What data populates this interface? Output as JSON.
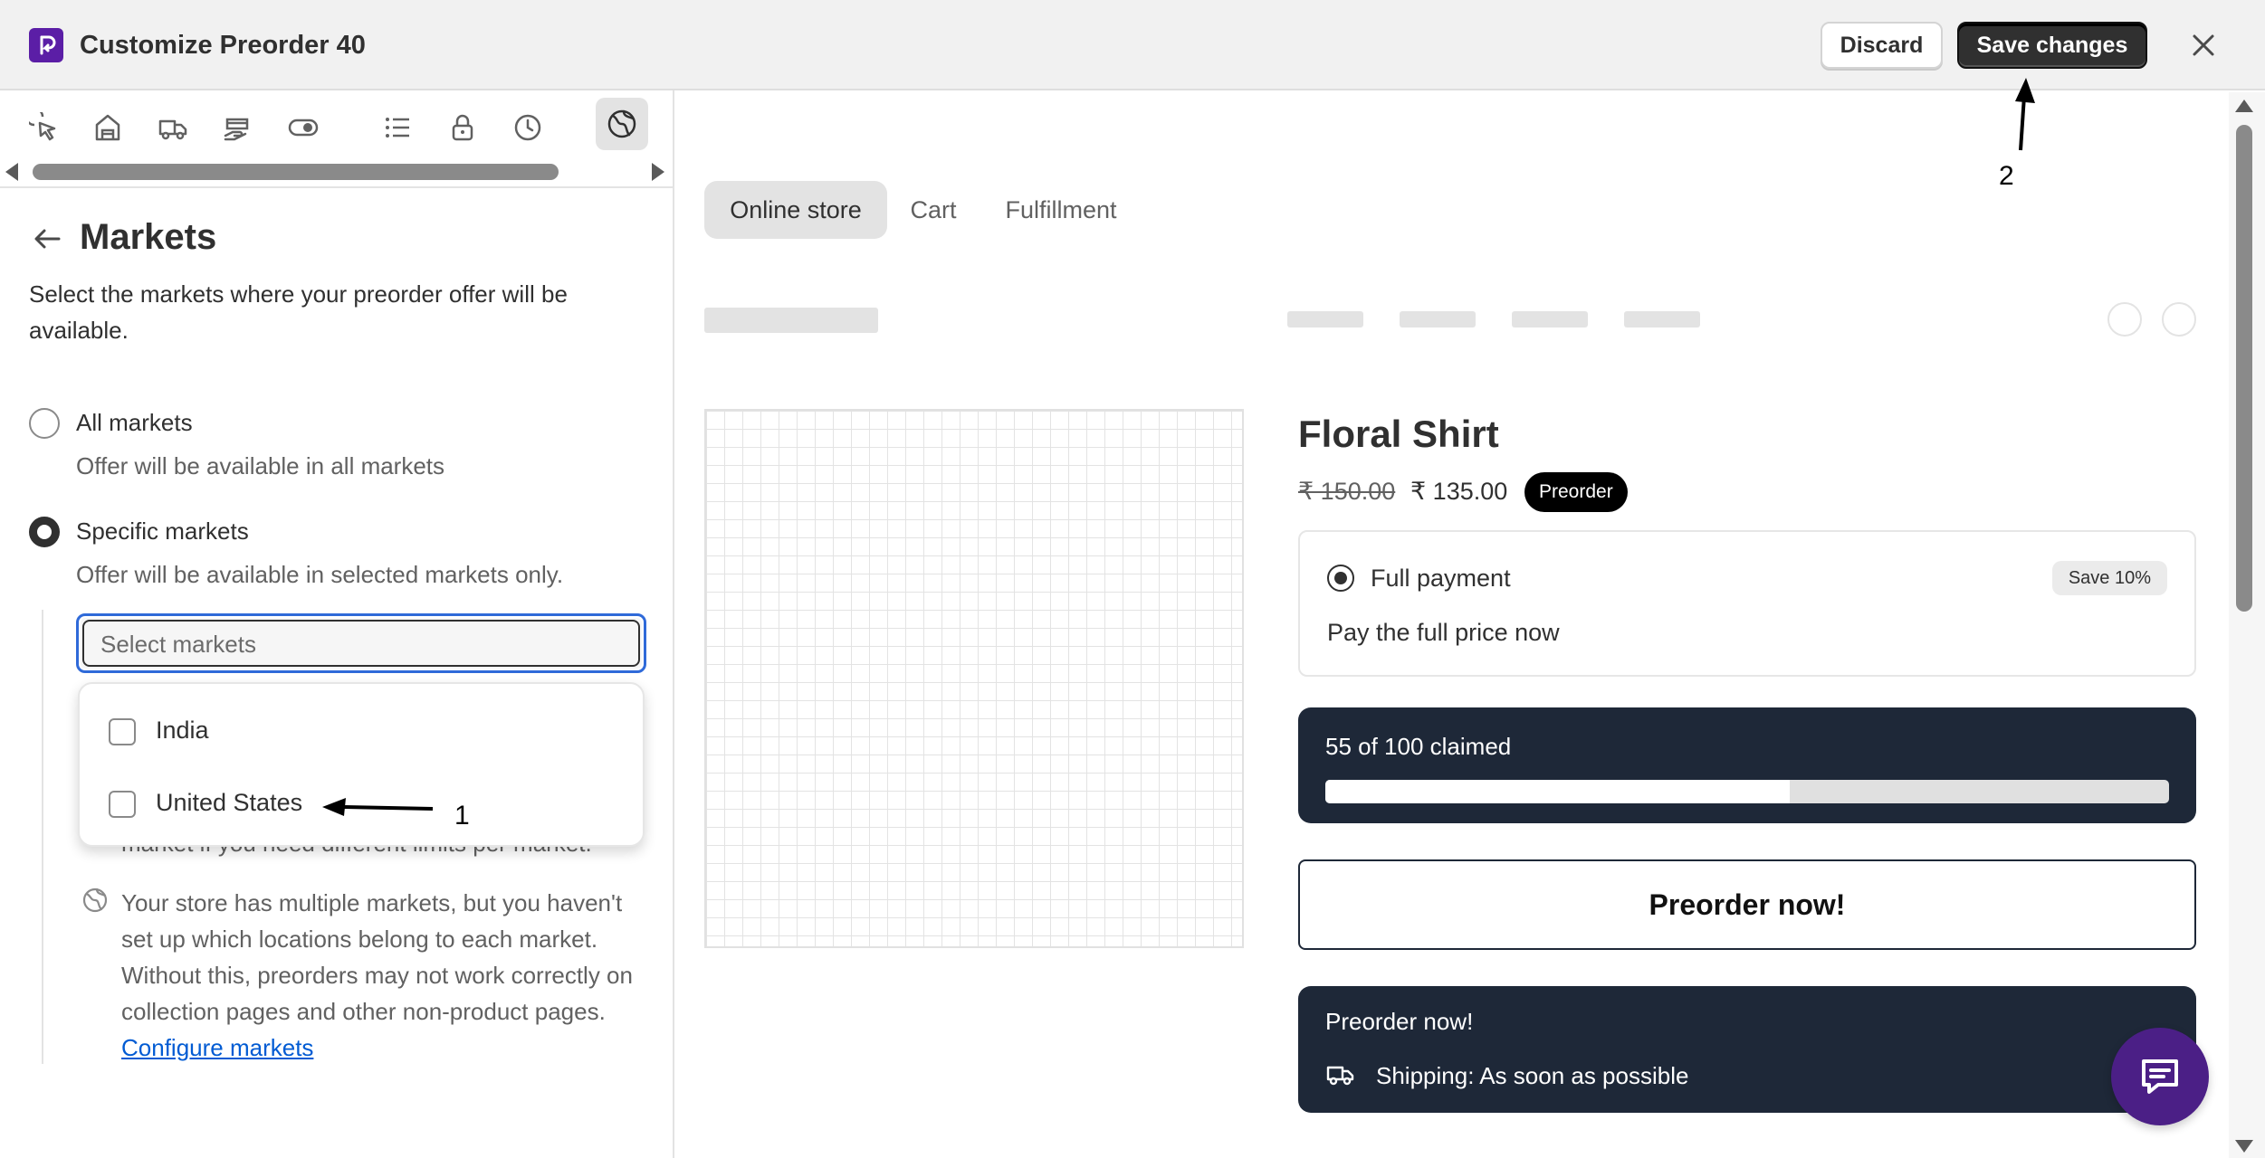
{
  "header": {
    "title": "Customize Preorder 40",
    "discard_label": "Discard",
    "save_label": "Save changes"
  },
  "sidebar": {
    "icon_tabs": [
      {
        "icon": "cursor-click-icon"
      },
      {
        "icon": "store-icon"
      },
      {
        "icon": "delivery-truck-icon"
      },
      {
        "icon": "payment-hand-icon"
      },
      {
        "icon": "toggle-icon"
      },
      {
        "icon": "list-icon"
      },
      {
        "icon": "lock-icon"
      },
      {
        "icon": "clock-icon"
      },
      {
        "icon": "globe-icon",
        "active": true
      }
    ],
    "section": {
      "title": "Markets",
      "description": "Select the markets where your preorder offer will be available."
    },
    "options": [
      {
        "label": "All markets",
        "help": "Offer will be available in all markets",
        "checked": false
      },
      {
        "label": "Specific markets",
        "help": "Offer will be available in selected markets only.",
        "checked": true
      }
    ],
    "select": {
      "placeholder": "Select markets"
    },
    "dropdown": [
      {
        "label": "India",
        "checked": false
      },
      {
        "label": "United States",
        "checked": false
      }
    ],
    "partially_hidden_text": "market if you need different limits per market.",
    "info": {
      "text": "Your store has multiple markets, but you haven't set up which locations belong to each market. Without this, preorders may not work correctly on collection pages and other non-product pages.",
      "link": "Configure markets"
    }
  },
  "annotations": {
    "first": "1",
    "second": "2"
  },
  "preview": {
    "tabs": [
      "Online store",
      "Cart",
      "Fulfillment"
    ],
    "active_tab": "Online store",
    "product": {
      "title": "Floral Shirt",
      "price_old": "₹ 150.00",
      "price_new": "₹ 135.00",
      "badge": "Preorder"
    },
    "payment": {
      "title": "Full payment",
      "badge": "Save 10%",
      "description": "Pay the full price now"
    },
    "claimed": {
      "text": "55 of 100 claimed",
      "claimed": 55,
      "total": 100
    },
    "cta": "Preorder now!",
    "shipping": {
      "title": "Preorder now!",
      "text": "Shipping: As soon as possible"
    }
  },
  "colors": {
    "accent": "#5b1ea6",
    "dark_card": "#1e2838",
    "focus": "#2f6ad9",
    "link": "#005bd3"
  }
}
